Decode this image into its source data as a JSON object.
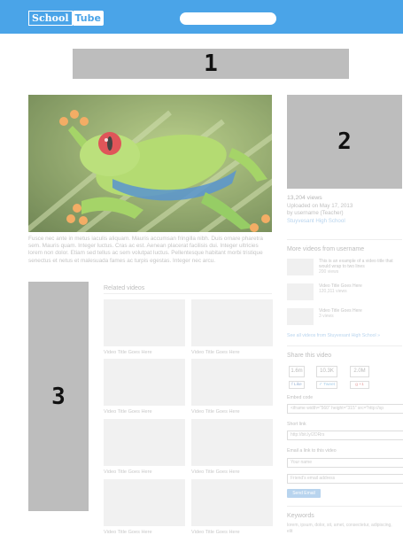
{
  "header": {
    "logo_part1": "School",
    "logo_part2": "Tube",
    "search_placeholder": ""
  },
  "ads": {
    "ad1": "1",
    "ad2": "2",
    "ad3": "3"
  },
  "description": "Fusce nec ante in metus iaculis aliquam. Mauris accumsan fringilla nibh. Duis ornare pharetra sem. Mauris quam. Integer luctus. Cras ac est. Aenean placerat facilisis dui. Integer ultricies lorem non dolor. Etiam sed tellus ac sem volutpat luctus. Pellentesque habitant morbi tristique senectus et netus et malesuada fames ac turpis egestas. Integer nec arcu.",
  "related": {
    "title": "Related videos",
    "items": [
      "Video Title Goes Here",
      "Video Title Goes Here",
      "Video Title Goes Here",
      "Video Title Goes Here",
      "Video Title Goes Here",
      "Video Title Goes Here",
      "Video Title Goes Here",
      "Video Title Goes Here"
    ]
  },
  "stats": {
    "views": "13,204 views",
    "uploaded": "Uploaded on May 17, 2013",
    "by": "by username (Teacher)",
    "school": "Stuyvesant High School"
  },
  "more_videos": {
    "title": "More videos from username",
    "items": [
      {
        "title": "This is an example of a video title that would wrap to two lines",
        "views": "200 views"
      },
      {
        "title": "Video Title Goes Here",
        "views": "120,311 views"
      },
      {
        "title": "Video Title Goes Here",
        "views": "3 views"
      }
    ],
    "see_all": "See all videos from Stuyvesant High School »"
  },
  "share": {
    "title": "Share this video",
    "counts": [
      "1.6m",
      "10.3K",
      "2.0M"
    ],
    "buttons": [
      "Like",
      "Tweet",
      "+1"
    ],
    "embed_label": "Embed code",
    "embed_value": "<iframe width=\"560\" height=\"315\" src=\"http://sp",
    "short_label": "Short link",
    "short_value": "http://bit.ly/2DRrs",
    "email_label": "Email a link to this video",
    "email_placeholder_1": "Your name",
    "email_placeholder_2": "Friend's email address",
    "send_label": "Send Email"
  },
  "keywords": {
    "title": "Keywords",
    "text": "lorem, ipsum, dolor, sit, amet, consectetur, adipiscing, elit"
  }
}
